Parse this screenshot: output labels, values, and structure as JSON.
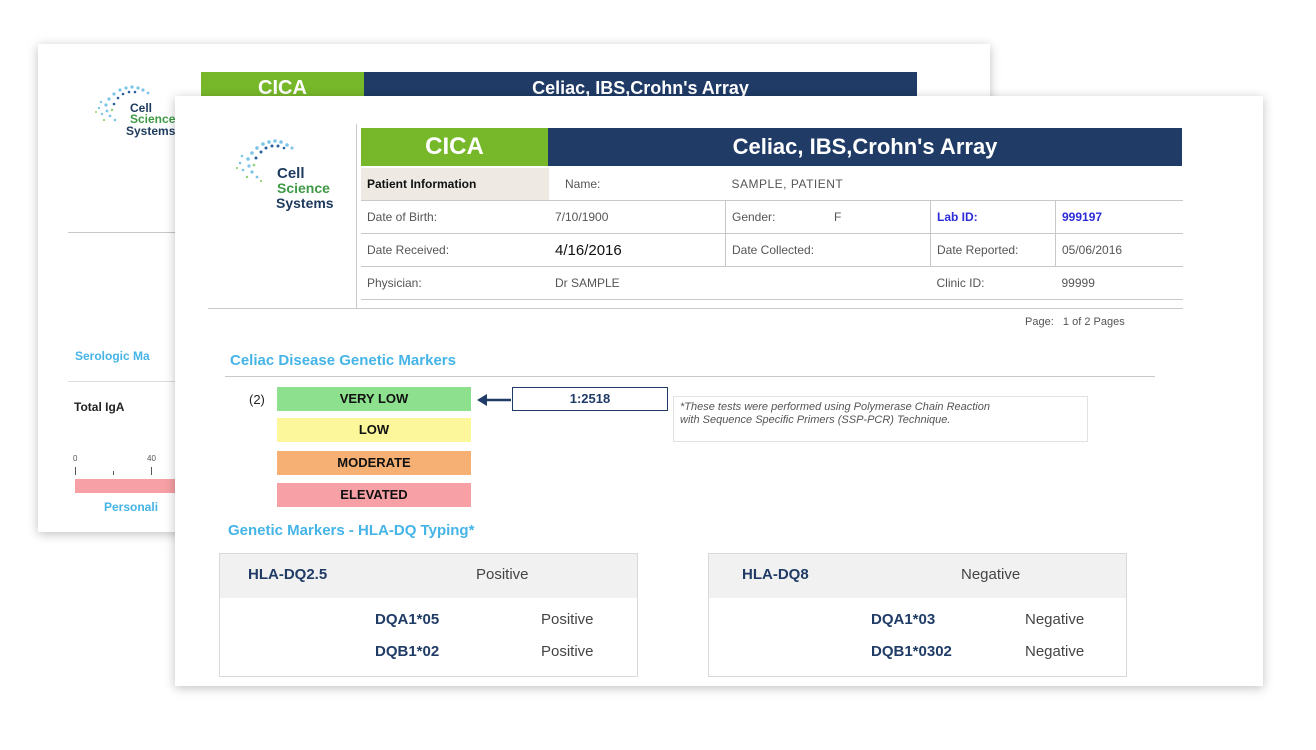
{
  "back": {
    "logo": {
      "line1": "Cell",
      "line2": "Science",
      "line3": "Systems"
    },
    "header": {
      "code": "CICA",
      "title": "Celiac, IBS,Crohn's Array"
    },
    "section_title": "Serologic Ma",
    "row_label": "Total IgA",
    "scale_ticks": [
      "0",
      "40"
    ],
    "footer": "Personali"
  },
  "front": {
    "logo": {
      "line1": "Cell",
      "line2": "Science",
      "line3": "Systems"
    },
    "header": {
      "code": "CICA",
      "title": "Celiac, IBS,Crohn's Array"
    },
    "patient_info": {
      "label": "Patient Information",
      "name_label": "Name:",
      "name_value": "SAMPLE, PATIENT",
      "dob_label": "Date of Birth:",
      "dob_value": "7/10/1900",
      "gender_label": "Gender:",
      "gender_value": "F",
      "lab_id_label": "Lab ID:",
      "lab_id_value": "999197",
      "received_label": "Date Received:",
      "received_value": "4/16/2016",
      "collected_label": "Date Collected:",
      "collected_value": "",
      "reported_label": "Date Reported:",
      "reported_value": "05/06/2016",
      "physician_label": "Physician:",
      "physician_value": "Dr SAMPLE",
      "clinic_label": "Clinic ID:",
      "clinic_value": "99999"
    },
    "page_label": "Page:",
    "page_value": "1 of 2 Pages",
    "celiac_section": {
      "title": "Celiac Disease Genetic Markers",
      "level_index": "(2)",
      "levels": [
        "VERY LOW",
        "LOW",
        "MODERATE",
        "ELEVATED"
      ],
      "result": "1:2518",
      "note_line1": "*These tests were performed using Polymerase Chain Reaction",
      "note_line2": "with Sequence Specific Primers (SSP-PCR) Technique."
    },
    "hla_section": {
      "title": "Genetic Markers - HLA-DQ Typing*",
      "panels": [
        {
          "name": "HLA-DQ2.5",
          "result": "Positive",
          "alleles": [
            {
              "name": "DQA1*05",
              "result": "Positive"
            },
            {
              "name": "DQB1*02",
              "result": "Positive"
            }
          ]
        },
        {
          "name": "HLA-DQ8",
          "result": "Negative",
          "alleles": [
            {
              "name": "DQA1*03",
              "result": "Negative"
            },
            {
              "name": "DQB1*0302",
              "result": "Negative"
            }
          ]
        }
      ]
    }
  },
  "colors": {
    "green": "#77b82a",
    "navy": "#1f3b66",
    "section_blue": "#45b4e6",
    "very_low": "#8de08d",
    "low": "#fbf79a",
    "moderate": "#f7b074",
    "elevated": "#f7a0a5"
  }
}
